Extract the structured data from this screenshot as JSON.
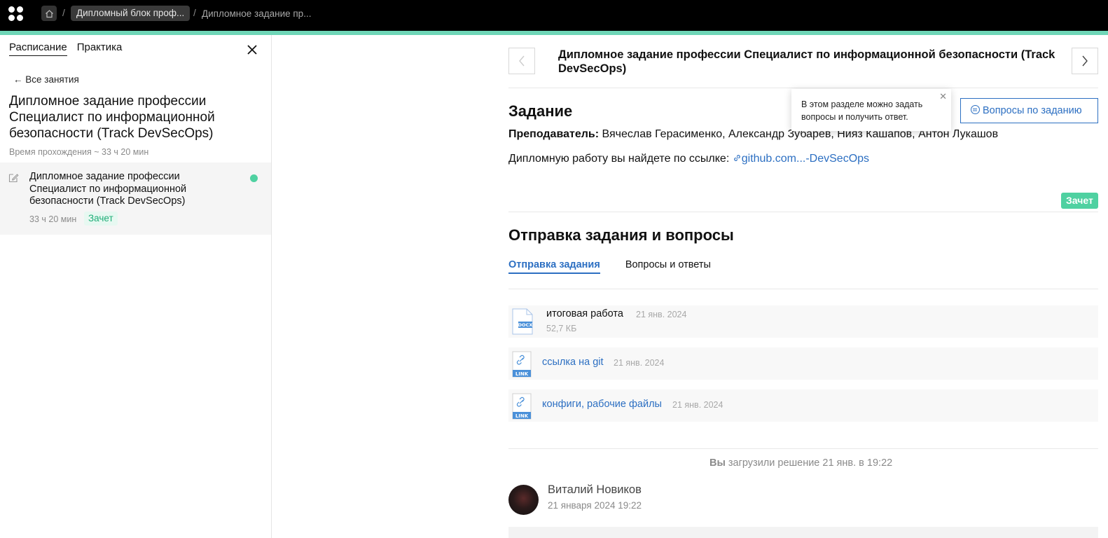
{
  "topbar": {
    "breadcrumb_pill": "Дипломный блок проф...",
    "breadcrumb_current": "Дипломное задание пр...",
    "separator": "/"
  },
  "sidebar": {
    "tabs": [
      {
        "label": "Расписание",
        "active": true
      },
      {
        "label": "Практика",
        "active": false
      }
    ],
    "all_lessons": "Все занятия",
    "title": "Дипломное задание профессии Специалист по информационной безопасности (Track DevSecOps)",
    "duration_label": "Время прохождения ~ 33 ч 20 мин",
    "lesson": {
      "title": "Дипломное задание профессии Специалист по информационной безопасности (Track DevSecOps)",
      "duration": "33 ч 20 мин",
      "status": "Зачет",
      "status_color": "#4fd1a1"
    }
  },
  "main": {
    "title": "Дипломное задание профессии Специалист по информационной безопасности (Track DevSecOps)",
    "section_task": "Задание",
    "teacher_label": "Преподаватель:",
    "teachers": "Вячеслав Герасименко, Александр Зубарев, Нияз Кашапов, Антон Лукашов",
    "diploma_text": "Дипломную работу вы найдете по ссылке:",
    "diploma_link": "github.com...-DevSecOps",
    "grade_badge": "Зачет",
    "tooltip_text": "В этом разделе можно задать вопросы и получить ответ.",
    "questions_button": "Вопросы по заданию",
    "section_submit": "Отправка задания и вопросы",
    "subtabs": [
      {
        "label": "Отправка задания",
        "active": true
      },
      {
        "label": "Вопросы и ответы",
        "active": false
      }
    ],
    "files": [
      {
        "name": "итоговая работа",
        "date": "21 янв. 2024",
        "size": "52,7 КБ",
        "type": "DOCX"
      },
      {
        "name": "ссылка на git",
        "date": "21 янв. 2024",
        "type": "LINK"
      },
      {
        "name": "конфиги, рабочие файлы",
        "date": "21 янв. 2024",
        "type": "LINK"
      }
    ],
    "uploaded_by": "Вы",
    "uploaded_text": "загрузили решение 21 янв. в 19:22",
    "comment": {
      "author": "Виталий Новиков",
      "date": "21 января 2024 19:22"
    }
  },
  "colors": {
    "accent": "#2c6fc2",
    "success": "#4fd1a1",
    "progress": "#6fd6b7"
  }
}
